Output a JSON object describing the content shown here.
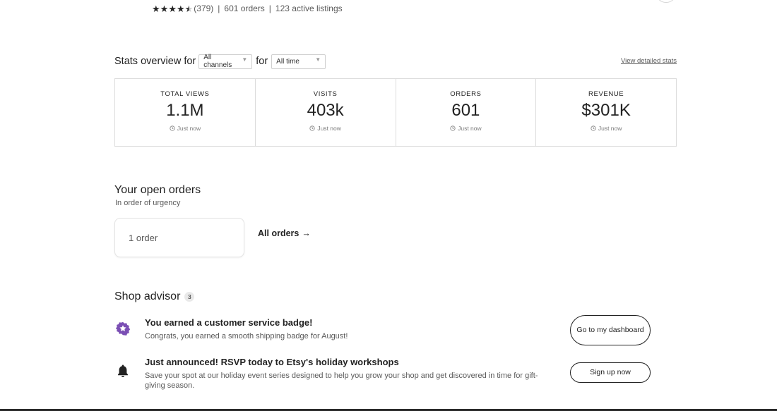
{
  "shop_summary": {
    "rating_stars": 4.5,
    "review_count": "(379)",
    "orders": "601 orders",
    "active_listings": "123 active listings"
  },
  "stats_overview": {
    "title": "Stats overview for",
    "channel_select": "All channels",
    "for_label": "for",
    "time_select": "All time",
    "view_detailed_link": "View detailed stats",
    "cards": [
      {
        "label": "TOTAL VIEWS",
        "value": "1.1M",
        "updated": "Just now"
      },
      {
        "label": "VISITS",
        "value": "403k",
        "updated": "Just now"
      },
      {
        "label": "ORDERS",
        "value": "601",
        "updated": "Just now"
      },
      {
        "label": "REVENUE",
        "value": "$301K",
        "updated": "Just now"
      }
    ]
  },
  "open_orders": {
    "title": "Your open orders",
    "subtitle": "In order of urgency",
    "order_card": "1 order",
    "all_orders_link": "All orders",
    "all_orders_arrow": "→"
  },
  "shop_advisor": {
    "title": "Shop advisor",
    "count": "3",
    "items": [
      {
        "icon": "badge-star-icon",
        "title": "You earned a customer service badge!",
        "description": "Congrats, you earned a smooth shipping badge for August!",
        "button": "Go to my dashboard"
      },
      {
        "icon": "bell-icon",
        "title": "Just announced! RSVP today to Etsy's holiday workshops",
        "description": "Save your spot at our holiday event series designed to help you grow your shop and get discovered in time for gift-giving season.",
        "button": "Sign up now"
      }
    ]
  },
  "colors": {
    "text": "#222222",
    "muted": "#595959",
    "badge_purple": "#7b4fb4",
    "border": "#dcdcdc"
  }
}
